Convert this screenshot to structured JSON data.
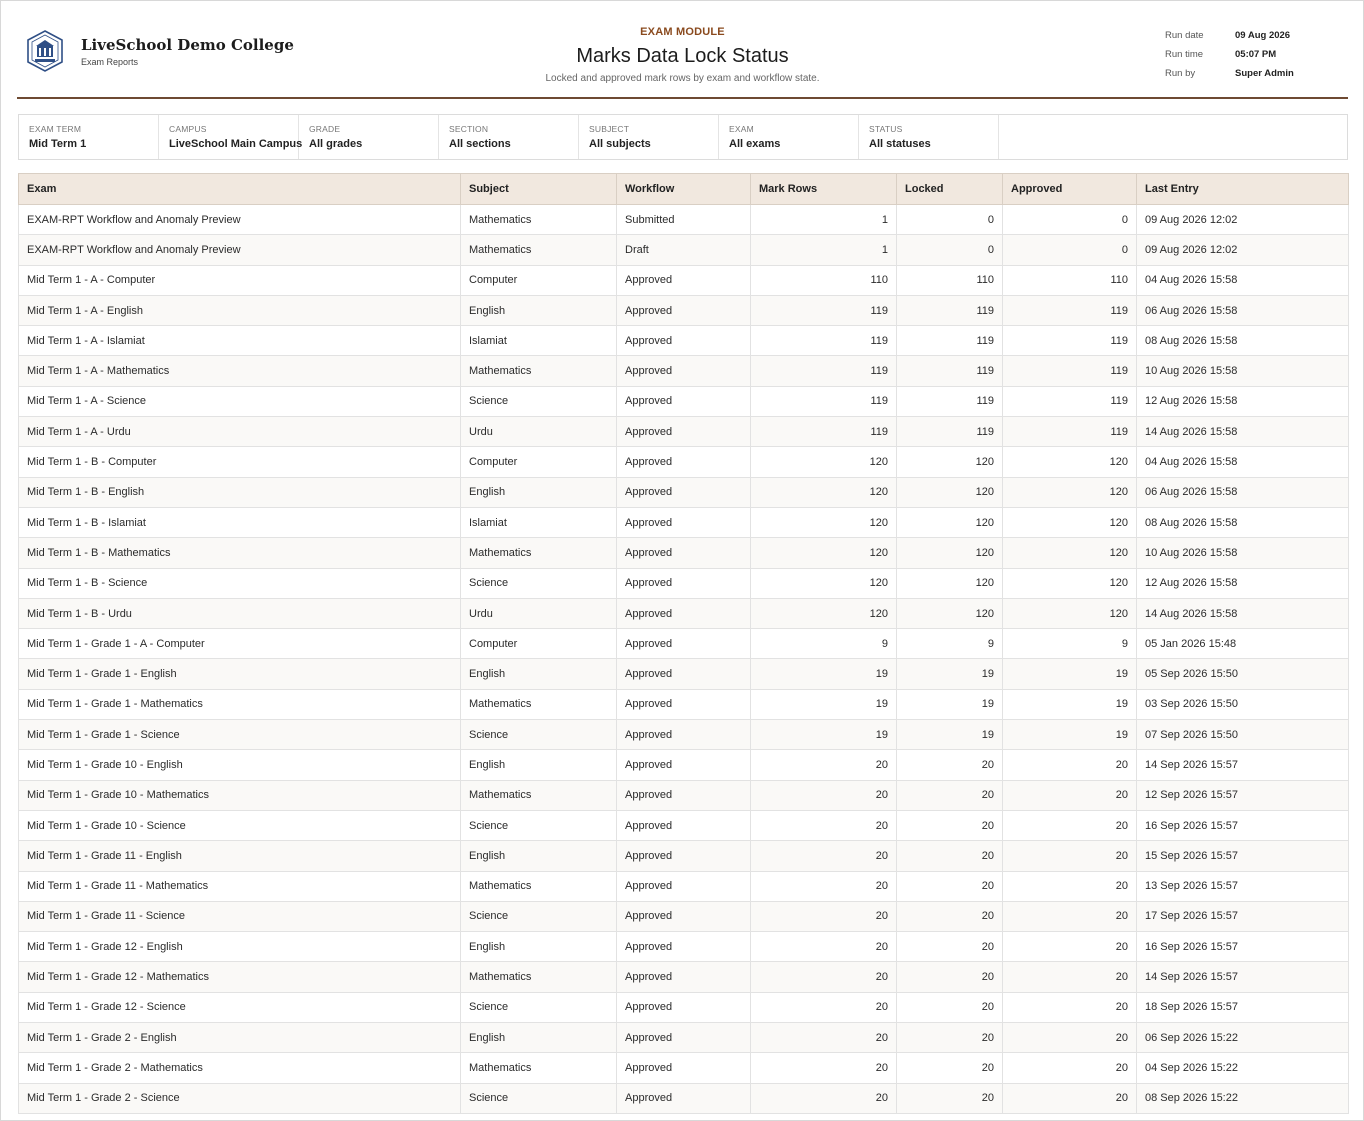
{
  "header": {
    "org_name": "LiveSchool Demo College",
    "org_sub": "Exam Reports",
    "module": "EXAM MODULE",
    "title": "Marks Data Lock Status",
    "subtitle": "Locked and approved mark rows by exam and workflow state.",
    "meta": [
      {
        "label": "Run date",
        "value": "09 Aug 2026"
      },
      {
        "label": "Run time",
        "value": "05:07 PM"
      },
      {
        "label": "Run by",
        "value": "Super Admin"
      }
    ]
  },
  "filters": [
    {
      "label": "Exam Term",
      "value": "Mid Term 1"
    },
    {
      "label": "Campus",
      "value": "LiveSchool Main Campus"
    },
    {
      "label": "Grade",
      "value": "All grades"
    },
    {
      "label": "Section",
      "value": "All sections"
    },
    {
      "label": "Subject",
      "value": "All subjects"
    },
    {
      "label": "Exam",
      "value": "All exams"
    },
    {
      "label": "Status",
      "value": "All statuses"
    }
  ],
  "table": {
    "columns": [
      "Exam",
      "Subject",
      "Workflow",
      "Mark Rows",
      "Locked",
      "Approved",
      "Last Entry"
    ],
    "rows": [
      [
        "EXAM-RPT Workflow and Anomaly Preview",
        "Mathematics",
        "Submitted",
        "1",
        "0",
        "0",
        "09 Aug 2026 12:02"
      ],
      [
        "EXAM-RPT Workflow and Anomaly Preview",
        "Mathematics",
        "Draft",
        "1",
        "0",
        "0",
        "09 Aug 2026 12:02"
      ],
      [
        "Mid Term 1 - A - Computer",
        "Computer",
        "Approved",
        "110",
        "110",
        "110",
        "04 Aug 2026 15:58"
      ],
      [
        "Mid Term 1 - A - English",
        "English",
        "Approved",
        "119",
        "119",
        "119",
        "06 Aug 2026 15:58"
      ],
      [
        "Mid Term 1 - A - Islamiat",
        "Islamiat",
        "Approved",
        "119",
        "119",
        "119",
        "08 Aug 2026 15:58"
      ],
      [
        "Mid Term 1 - A - Mathematics",
        "Mathematics",
        "Approved",
        "119",
        "119",
        "119",
        "10 Aug 2026 15:58"
      ],
      [
        "Mid Term 1 - A - Science",
        "Science",
        "Approved",
        "119",
        "119",
        "119",
        "12 Aug 2026 15:58"
      ],
      [
        "Mid Term 1 - A - Urdu",
        "Urdu",
        "Approved",
        "119",
        "119",
        "119",
        "14 Aug 2026 15:58"
      ],
      [
        "Mid Term 1 - B - Computer",
        "Computer",
        "Approved",
        "120",
        "120",
        "120",
        "04 Aug 2026 15:58"
      ],
      [
        "Mid Term 1 - B - English",
        "English",
        "Approved",
        "120",
        "120",
        "120",
        "06 Aug 2026 15:58"
      ],
      [
        "Mid Term 1 - B - Islamiat",
        "Islamiat",
        "Approved",
        "120",
        "120",
        "120",
        "08 Aug 2026 15:58"
      ],
      [
        "Mid Term 1 - B - Mathematics",
        "Mathematics",
        "Approved",
        "120",
        "120",
        "120",
        "10 Aug 2026 15:58"
      ],
      [
        "Mid Term 1 - B - Science",
        "Science",
        "Approved",
        "120",
        "120",
        "120",
        "12 Aug 2026 15:58"
      ],
      [
        "Mid Term 1 - B - Urdu",
        "Urdu",
        "Approved",
        "120",
        "120",
        "120",
        "14 Aug 2026 15:58"
      ],
      [
        "Mid Term 1 - Grade 1 - A - Computer",
        "Computer",
        "Approved",
        "9",
        "9",
        "9",
        "05 Jan 2026 15:48"
      ],
      [
        "Mid Term 1 - Grade 1 - English",
        "English",
        "Approved",
        "19",
        "19",
        "19",
        "05 Sep 2026 15:50"
      ],
      [
        "Mid Term 1 - Grade 1 - Mathematics",
        "Mathematics",
        "Approved",
        "19",
        "19",
        "19",
        "03 Sep 2026 15:50"
      ],
      [
        "Mid Term 1 - Grade 1 - Science",
        "Science",
        "Approved",
        "19",
        "19",
        "19",
        "07 Sep 2026 15:50"
      ],
      [
        "Mid Term 1 - Grade 10 - English",
        "English",
        "Approved",
        "20",
        "20",
        "20",
        "14 Sep 2026 15:57"
      ],
      [
        "Mid Term 1 - Grade 10 - Mathematics",
        "Mathematics",
        "Approved",
        "20",
        "20",
        "20",
        "12 Sep 2026 15:57"
      ],
      [
        "Mid Term 1 - Grade 10 - Science",
        "Science",
        "Approved",
        "20",
        "20",
        "20",
        "16 Sep 2026 15:57"
      ],
      [
        "Mid Term 1 - Grade 11 - English",
        "English",
        "Approved",
        "20",
        "20",
        "20",
        "15 Sep 2026 15:57"
      ],
      [
        "Mid Term 1 - Grade 11 - Mathematics",
        "Mathematics",
        "Approved",
        "20",
        "20",
        "20",
        "13 Sep 2026 15:57"
      ],
      [
        "Mid Term 1 - Grade 11 - Science",
        "Science",
        "Approved",
        "20",
        "20",
        "20",
        "17 Sep 2026 15:57"
      ],
      [
        "Mid Term 1 - Grade 12 - English",
        "English",
        "Approved",
        "20",
        "20",
        "20",
        "16 Sep 2026 15:57"
      ],
      [
        "Mid Term 1 - Grade 12 - Mathematics",
        "Mathematics",
        "Approved",
        "20",
        "20",
        "20",
        "14 Sep 2026 15:57"
      ],
      [
        "Mid Term 1 - Grade 12 - Science",
        "Science",
        "Approved",
        "20",
        "20",
        "20",
        "18 Sep 2026 15:57"
      ],
      [
        "Mid Term 1 - Grade 2 - English",
        "English",
        "Approved",
        "20",
        "20",
        "20",
        "06 Sep 2026 15:22"
      ],
      [
        "Mid Term 1 - Grade 2 - Mathematics",
        "Mathematics",
        "Approved",
        "20",
        "20",
        "20",
        "04 Sep 2026 15:22"
      ],
      [
        "Mid Term 1 - Grade 2 - Science",
        "Science",
        "Approved",
        "20",
        "20",
        "20",
        "08 Sep 2026 15:22"
      ]
    ]
  }
}
